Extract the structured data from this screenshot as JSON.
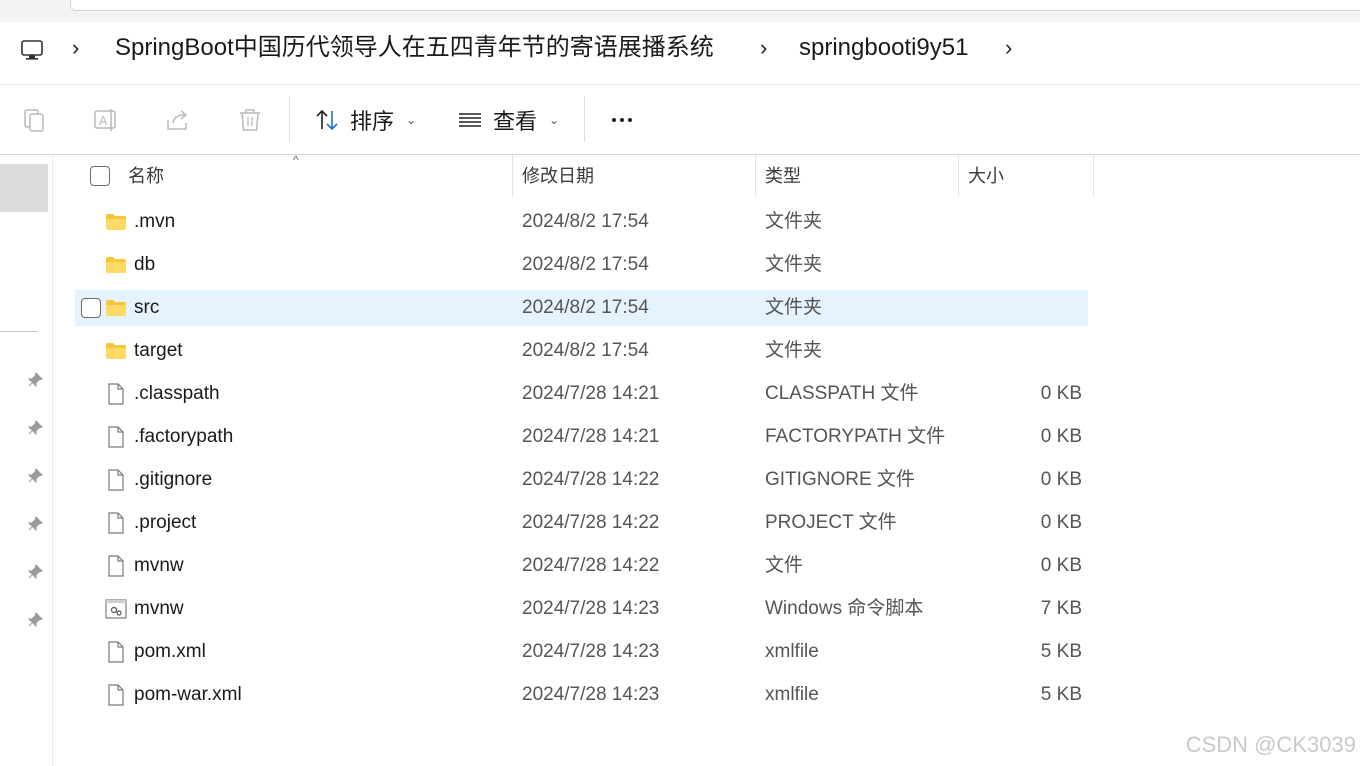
{
  "breadcrumb": {
    "icon": "computer-icon",
    "items": [
      "SpringBoot中国历代领导人在五四青年节的寄语展播系统",
      "springbooti9y51"
    ]
  },
  "toolbar": {
    "icons": [
      "copy-icon",
      "rename-icon",
      "share-icon",
      "delete-icon"
    ],
    "sort_label": "排序",
    "view_label": "查看",
    "more_icon": "more-icon"
  },
  "columns": {
    "name": "名称",
    "date": "修改日期",
    "type": "类型",
    "size": "大小"
  },
  "files": [
    {
      "name": ".mvn",
      "date": "2024/8/2 17:54",
      "type": "文件夹",
      "size": "",
      "icon": "folder-icon"
    },
    {
      "name": "db",
      "date": "2024/8/2 17:54",
      "type": "文件夹",
      "size": "",
      "icon": "folder-icon"
    },
    {
      "name": "src",
      "date": "2024/8/2 17:54",
      "type": "文件夹",
      "size": "",
      "icon": "folder-icon",
      "selected": true
    },
    {
      "name": "target",
      "date": "2024/8/2 17:54",
      "type": "文件夹",
      "size": "",
      "icon": "folder-icon"
    },
    {
      "name": ".classpath",
      "date": "2024/7/28 14:21",
      "type": "CLASSPATH 文件",
      "size": "0 KB",
      "icon": "file-icon"
    },
    {
      "name": ".factorypath",
      "date": "2024/7/28 14:21",
      "type": "FACTORYPATH 文件",
      "size": "0 KB",
      "icon": "file-icon"
    },
    {
      "name": ".gitignore",
      "date": "2024/7/28 14:22",
      "type": "GITIGNORE 文件",
      "size": "0 KB",
      "icon": "file-icon"
    },
    {
      "name": ".project",
      "date": "2024/7/28 14:22",
      "type": "PROJECT 文件",
      "size": "0 KB",
      "icon": "file-icon"
    },
    {
      "name": "mvnw",
      "date": "2024/7/28 14:22",
      "type": "文件",
      "size": "0 KB",
      "icon": "file-icon"
    },
    {
      "name": "mvnw",
      "date": "2024/7/28 14:23",
      "type": "Windows 命令脚本",
      "size": "7 KB",
      "icon": "script-icon"
    },
    {
      "name": "pom.xml",
      "date": "2024/7/28 14:23",
      "type": "xmlfile",
      "size": "5 KB",
      "icon": "file-icon"
    },
    {
      "name": "pom-war.xml",
      "date": "2024/7/28 14:23",
      "type": "xmlfile",
      "size": "5 KB",
      "icon": "file-icon"
    }
  ],
  "watermark": "CSDN @CK3039",
  "colors": {
    "selected_row": "#e5f3ff",
    "folder": "#f8c53a"
  }
}
